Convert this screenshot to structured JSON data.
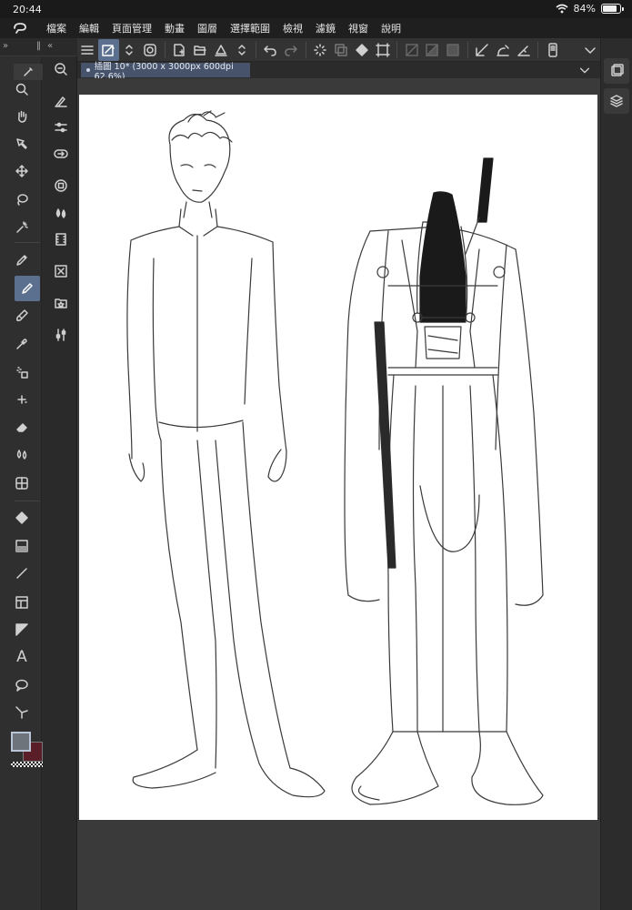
{
  "status": {
    "time": "20:44",
    "battery": "84%",
    "battery_level": 0.84
  },
  "menu": [
    "檔案",
    "編輯",
    "頁面管理",
    "動畫",
    "圖層",
    "選擇範圍",
    "檢視",
    "濾鏡",
    "視窗",
    "說明"
  ],
  "canvas": {
    "tab_label": "插圖 10* (3000 x 3000px 600dpi 62.6%)"
  },
  "colors": {
    "main": "#6e747c",
    "sub": "#5a1e28",
    "accent": "#5b6f8e"
  },
  "tools": [
    "zoom-icon",
    "hand-icon",
    "rotate-icon",
    "move-icon",
    "lasso-select-icon",
    "magic-wand-icon",
    "pen-icon",
    "pencil-icon",
    "brush-icon",
    "eyedropper-icon",
    "airbrush-icon",
    "decoration-icon",
    "eraser-icon",
    "blend-icon",
    "figure-icon",
    "fill-icon",
    "gradient-icon",
    "line-icon",
    "frame-icon",
    "ruler-icon",
    "text-icon",
    "balloon-icon",
    "correct-line-icon"
  ],
  "sub_tools": [
    "navigator-icon",
    "tool-property-icon",
    "brush-size-icon",
    "sub-tool-icon",
    "color-wheel-icon",
    "color-set-icon",
    "animation-icon",
    "material-icon",
    "library-icon",
    "adjust-icon"
  ]
}
